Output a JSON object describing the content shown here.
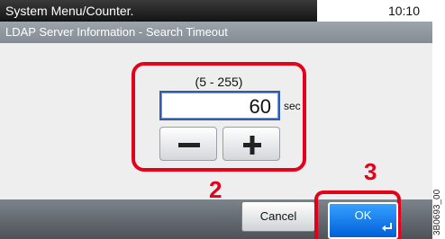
{
  "header": {
    "title": "System Menu/Counter.",
    "clock": "10:10"
  },
  "subheader": {
    "title": "LDAP Server Information - Search Timeout"
  },
  "setting": {
    "range": "(5 - 255)",
    "value": "60",
    "unit": "sec"
  },
  "stepper": {
    "decrease_icon": "minus-icon",
    "increase_icon": "plus-icon"
  },
  "footer": {
    "cancel_label": "Cancel",
    "ok_label": "OK",
    "ok_icon": "enter-icon"
  },
  "callouts": {
    "step_2": "2",
    "step_3": "3"
  },
  "figure_code": "3B0693_00",
  "colors": {
    "callout_red": "#e4001b",
    "ok_blue": "#0a74ec",
    "input_border": "#2f5cab"
  }
}
